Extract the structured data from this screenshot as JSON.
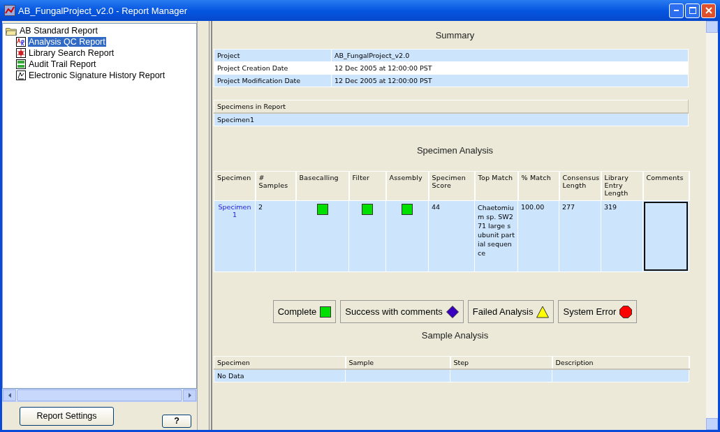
{
  "window": {
    "title": "AB_FungalProject_v2.0 - Report Manager"
  },
  "tree": {
    "label": "AB Standard Report",
    "expanded": true,
    "children": [
      {
        "label": "Analysis QC Report",
        "kind": "qc",
        "selected": true
      },
      {
        "label": "Library Search Report",
        "kind": "search",
        "selected": false
      },
      {
        "label": "Audit Trail Report",
        "kind": "audit",
        "selected": false
      },
      {
        "label": "Electronic Signature History Report",
        "kind": "signature",
        "selected": false
      }
    ]
  },
  "left_buttons": {
    "settings": "Report Settings",
    "help": "?"
  },
  "summary": {
    "title": "Summary",
    "rows": [
      {
        "label": "Project",
        "value": "AB_FungalProject_v2.0"
      },
      {
        "label": "Project Creation Date",
        "value": "12 Dec 2005 at 12:00:00 PST"
      },
      {
        "label": "Project Modification Date",
        "value": "12 Dec 2005 at 12:00:00 PST"
      }
    ]
  },
  "specimens": {
    "heading": "Specimens in Report",
    "rows": [
      "Specimen1"
    ]
  },
  "specimen_analysis": {
    "title": "Specimen Analysis",
    "columns": [
      "Specimen",
      "# Samples",
      "Basecalling",
      "Filter",
      "Assembly",
      "Specimen Score",
      "Top Match",
      "% Match",
      "Consensus Length",
      "Library Entry Length",
      "Comments"
    ],
    "rows": [
      {
        "specimen": "Specimen1",
        "samples": "2",
        "basecalling": {
          "kind": "complete"
        },
        "filter": {
          "kind": "complete"
        },
        "assembly": {
          "kind": "complete"
        },
        "score": "44",
        "top_match": "Chaetomium sp. SW271 large subunit partial sequence",
        "match": "100.00",
        "consensus_length": "277",
        "library_length": "319"
      }
    ]
  },
  "legend": [
    {
      "label": "Complete",
      "kind": "complete"
    },
    {
      "label": "Success with comments",
      "kind": "success"
    },
    {
      "label": "Failed Analysis",
      "kind": "failed"
    },
    {
      "label": "System Error",
      "kind": "error"
    }
  ],
  "sample_analysis": {
    "title": "Sample Analysis",
    "columns": [
      "Specimen",
      "Sample",
      "Step",
      "Description"
    ],
    "rows": [
      [
        "No Data",
        "",
        "",
        ""
      ]
    ]
  }
}
